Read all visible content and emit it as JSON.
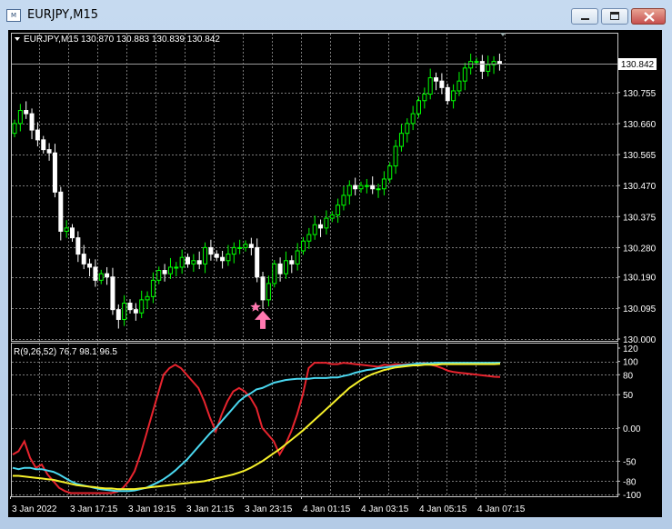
{
  "window": {
    "title": "EURJPY,M15",
    "icons": {
      "app": "chart-window-icon",
      "minimize": "minimize-icon",
      "maximize": "maximize-icon",
      "close": "close-icon"
    }
  },
  "main_header": {
    "symbol": "EURJPY,M15",
    "ohlc": "130.870 130.883 130.839 130.842",
    "menu_icon": "triangle-down-icon"
  },
  "price_label": "130.842",
  "y_labels": [
    "130.755",
    "130.660",
    "130.565",
    "130.470",
    "130.375",
    "130.280",
    "130.190",
    "130.095",
    "130.000"
  ],
  "indicator_header": "R(9,26,52) 76.7 98.1 96.5",
  "indicator_y_labels": [
    "120",
    "100",
    "80",
    "50",
    "0.00",
    "-50",
    "-80",
    "-100"
  ],
  "x_labels": [
    "3 Jan 2022",
    "3 Jan 17:15",
    "3 Jan 19:15",
    "3 Jan 21:15",
    "3 Jan 23:15",
    "4 Jan 01:15",
    "4 Jan 03:15",
    "4 Jan 05:15",
    "4 Jan 07:15"
  ],
  "colors": {
    "background": "#000000",
    "bull_candle": "#00ff00",
    "bear_candle": "#ffffff",
    "grid": "#7a7a7a",
    "line_fast": "#e8242e",
    "line_mid": "#4ad8f0",
    "line_slow": "#f6f02a",
    "signal": "#ff78b0"
  },
  "chart_data": [
    {
      "type": "candlestick",
      "title": "EURJPY,M15",
      "ylim": [
        130.0,
        130.842
      ],
      "x": [
        "3 Jan 2022",
        "3 Jan 17:15",
        "3 Jan 19:15",
        "3 Jan 21:15",
        "3 Jan 23:15",
        "4 Jan 01:15",
        "4 Jan 03:15",
        "4 Jan 05:15",
        "4 Jan 07:15"
      ],
      "closes": [
        130.66,
        130.7,
        130.69,
        130.64,
        130.61,
        130.58,
        130.57,
        130.45,
        130.33,
        130.34,
        130.31,
        130.26,
        130.23,
        130.22,
        130.18,
        130.2,
        130.19,
        130.09,
        130.06,
        130.11,
        130.09,
        130.08,
        130.12,
        130.13,
        130.18,
        130.21,
        130.2,
        130.22,
        130.22,
        130.25,
        130.23,
        130.24,
        130.23,
        130.28,
        130.26,
        130.25,
        130.24,
        130.26,
        130.28,
        130.28,
        130.29,
        130.28,
        130.19,
        130.12,
        130.17,
        130.23,
        130.2,
        130.24,
        130.23,
        130.27,
        130.3,
        130.32,
        130.35,
        130.34,
        130.37,
        130.38,
        130.41,
        130.44,
        130.47,
        130.46,
        130.47,
        130.47,
        130.46,
        130.46,
        130.49,
        130.53,
        130.59,
        130.63,
        130.66,
        130.69,
        130.73,
        130.75,
        130.8,
        130.79,
        130.77,
        130.73,
        130.76,
        130.79,
        130.83,
        130.85,
        130.85,
        130.82,
        130.84,
        130.85,
        130.842
      ],
      "signal": {
        "type": "buy-arrow",
        "index": 43,
        "price": 130.07
      }
    },
    {
      "type": "line",
      "title": "R(9,26,52)",
      "ylim": [
        -100,
        120
      ],
      "series": [
        {
          "name": "R9",
          "last": 76.7,
          "values": [
            -40,
            -35,
            -20,
            -45,
            -60,
            -55,
            -70,
            -80,
            -90,
            -95,
            -98,
            -98,
            -98,
            -98,
            -98,
            -98,
            -98,
            -98,
            -96,
            -90,
            -80,
            -65,
            -40,
            -10,
            20,
            50,
            80,
            90,
            95,
            90,
            80,
            70,
            60,
            40,
            15,
            -5,
            20,
            40,
            55,
            60,
            55,
            45,
            30,
            0,
            -10,
            -20,
            -40,
            -25,
            -5,
            20,
            50,
            90,
            98,
            98,
            98,
            96,
            96,
            98,
            97,
            96,
            95,
            94,
            93,
            92,
            95,
            94,
            96,
            95,
            96,
            95,
            97,
            98,
            95,
            93,
            90,
            86,
            84,
            83,
            82,
            81,
            80,
            79,
            78,
            77,
            76.7
          ]
        },
        {
          "name": "R26",
          "last": 98.1,
          "values": [
            -60,
            -62,
            -60,
            -60,
            -62,
            -62,
            -64,
            -66,
            -70,
            -75,
            -80,
            -84,
            -86,
            -88,
            -90,
            -92,
            -93,
            -94,
            -95,
            -95,
            -95,
            -94,
            -92,
            -90,
            -86,
            -82,
            -77,
            -71,
            -64,
            -56,
            -48,
            -38,
            -28,
            -18,
            -8,
            0,
            10,
            20,
            30,
            40,
            47,
            52,
            58,
            60,
            64,
            68,
            70,
            72,
            73,
            74,
            74,
            74,
            75,
            75,
            75,
            76,
            76,
            78,
            80,
            83,
            85,
            87,
            88,
            90,
            91,
            92,
            93,
            94,
            95,
            96,
            97,
            97,
            97,
            98,
            98,
            98,
            98,
            98,
            98,
            98,
            98,
            98,
            98,
            98,
            98.1
          ]
        },
        {
          "name": "R52",
          "last": 96.5,
          "values": [
            -72,
            -72,
            -73,
            -74,
            -75,
            -76,
            -77,
            -78,
            -80,
            -82,
            -84,
            -86,
            -87,
            -88,
            -89,
            -90,
            -91,
            -91,
            -92,
            -92,
            -92,
            -92,
            -91,
            -90,
            -89,
            -88,
            -87,
            -86,
            -85,
            -84,
            -83,
            -82,
            -81,
            -80,
            -78,
            -76,
            -74,
            -72,
            -70,
            -67,
            -64,
            -60,
            -55,
            -50,
            -44,
            -38,
            -32,
            -25,
            -18,
            -11,
            -4,
            4,
            12,
            20,
            28,
            36,
            44,
            52,
            60,
            66,
            72,
            77,
            81,
            84,
            87,
            89,
            91,
            92,
            93,
            94,
            94,
            95,
            95,
            95,
            96,
            96,
            96,
            96,
            96,
            96,
            96,
            96,
            96,
            96,
            96.5
          ]
        }
      ]
    }
  ]
}
